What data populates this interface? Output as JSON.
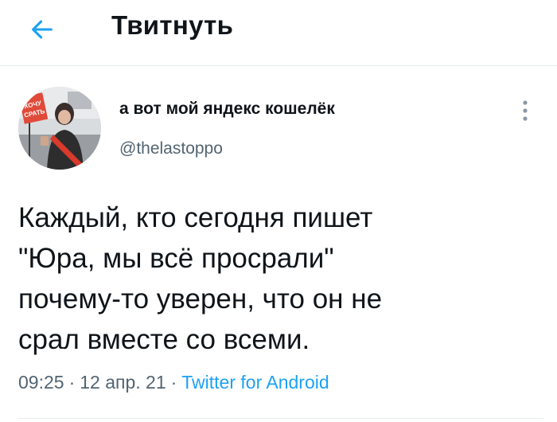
{
  "header": {
    "title": "Твитнуть",
    "back_icon": "arrow-left-icon"
  },
  "tweet": {
    "author": {
      "display_name": "а вот мой яндекс кошелёк",
      "handle": "@thelastoppo",
      "avatar_sign_text": "ХОЧУ СРАТЬ"
    },
    "text": "Каждый, кто сегодня пишет\n\"Юра, мы всё просрали\"\nпочему-то уверен, что он не\nсрал вместе со всеми.",
    "time": "09:25",
    "date": "12 апр. 21",
    "separator": "·",
    "source": "Twitter for Android",
    "more_icon": "more-vertical-icon"
  },
  "colors": {
    "accent": "#1da1f2",
    "text": "#0f1419",
    "secondary_text": "#536471",
    "divider": "#e6ecf0"
  }
}
